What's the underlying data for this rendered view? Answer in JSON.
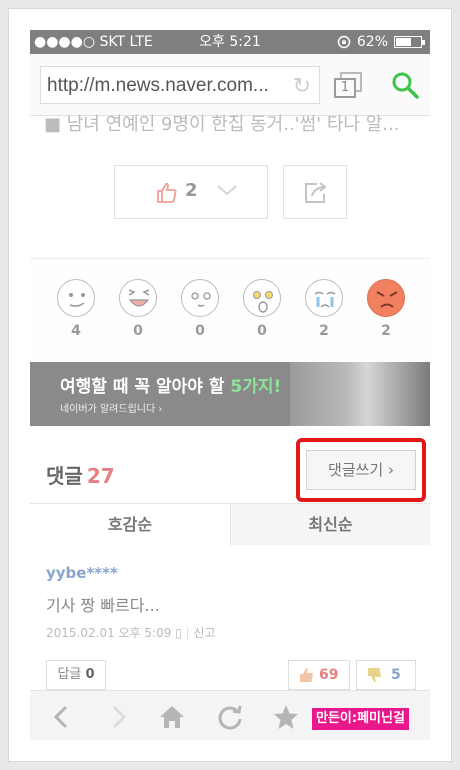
{
  "status_bar": {
    "carrier": "●●●●○ SKT  LTE",
    "time": "오후 5:21",
    "battery_pct": "62%",
    "battery_level": 0.62
  },
  "browser": {
    "url": "http://m.news.naver.com...",
    "tab_count": "1"
  },
  "article": {
    "headline_partial": "■ 남녀 연예인 9명이 한집 동거..'썸' 타나 알..."
  },
  "reactions": {
    "like_count": "2"
  },
  "emotions": [
    {
      "icon": "thumbs-up-face-icon",
      "count": "4"
    },
    {
      "icon": "laughing-face-icon",
      "count": "0"
    },
    {
      "icon": "heart-eyes-face-icon",
      "count": "0"
    },
    {
      "icon": "shocked-face-icon",
      "count": "0"
    },
    {
      "icon": "crying-face-icon",
      "count": "2"
    },
    {
      "icon": "angry-face-icon",
      "count": "2"
    }
  ],
  "banner": {
    "title_main": "여행할 때 꼭 알아야 할 ",
    "title_accent": "5가지!",
    "subtitle": "네이버가 알려드립니다 ›",
    "accent_color": "#8fe29a"
  },
  "comments": {
    "title": "댓글",
    "count": "27",
    "write_label": "댓글쓰기 ›",
    "sort_tabs": [
      "호감순",
      "최신순"
    ],
    "items": [
      {
        "author": "yybe****",
        "text": "기사 짱 빠르다...",
        "timestamp": "2015.02.01 오후 5:09",
        "report_label": "신고",
        "reply_label": "답글",
        "reply_count": "0",
        "up_count": "69",
        "down_count": "5"
      }
    ]
  },
  "watermark": "만든이:페미닌걸",
  "colors": {
    "highlight": "#e21818",
    "like": "#e68080",
    "dislike": "#8aa5cf",
    "search_green": "#3ec34b"
  }
}
